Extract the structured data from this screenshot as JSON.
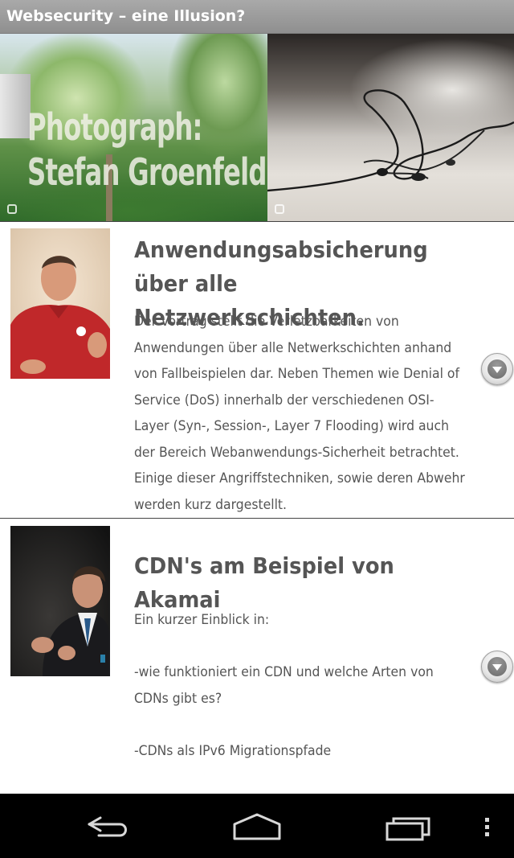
{
  "app": {
    "title": "Websecurity – eine Illusion?"
  },
  "hero": {
    "photo_credit_line1": "Photograph:",
    "photo_credit_line2": "Stefan Groenfeld"
  },
  "talks": [
    {
      "title": "Anwendungsabsicherung über alle Netzwerkschichten.",
      "description": "Der Vortrag stellt die Verletzbarkeiten von Anwendungen über alle Netwerkschichten anhand von Fallbeispielen dar. Neben Themen wie Denial of Service (DoS) innerhalb der verschiedenen OSI-Layer (Syn-, Session-, Layer 7 Flooding) wird auch der Bereich Webanwendungs-Sicherheit betrachtet. Einige dieser Angriffstechniken, sowie deren Abwehr werden kurz dargestellt.",
      "expand_icon": "chevron-down-icon"
    },
    {
      "title": "CDN's am Beispiel von Akamai",
      "description": "Ein kurzer Einblick in:\n\n-wie funktioniert ein CDN und welche Arten von CDNs gibt es?\n\n-CDNs als IPv6 Migrationspfade",
      "expand_icon": "chevron-down-icon"
    }
  ],
  "navbar": {
    "back_icon": "back-icon",
    "home_icon": "home-icon",
    "recents_icon": "recent-apps-icon",
    "menu_icon": "overflow-menu-icon"
  },
  "colors": {
    "titlebar": "#999999",
    "text": "#555555",
    "navbar": "#000000"
  }
}
